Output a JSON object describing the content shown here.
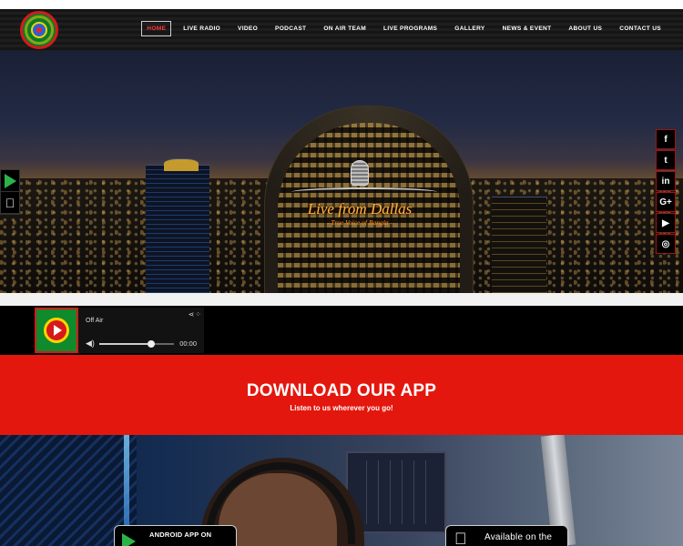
{
  "nav": {
    "items": [
      {
        "label": "HOME",
        "active": true
      },
      {
        "label": "LIVE RADIO"
      },
      {
        "label": "VIDEO"
      },
      {
        "label": "PODCAST"
      },
      {
        "label": "ON AIR TEAM"
      },
      {
        "label": "LIVE PROGRAMS"
      },
      {
        "label": "GALLERY"
      },
      {
        "label": "NEWS & EVENT"
      },
      {
        "label": "ABOUT US"
      },
      {
        "label": "CONTACT US"
      }
    ]
  },
  "hero": {
    "title": "Live from Dallas",
    "subtitle": "- True Voice of Bangla -"
  },
  "social": {
    "icons": [
      "facebook-icon",
      "twitter-icon",
      "linkedin-icon",
      "google-plus-icon",
      "youtube-icon",
      "instagram-icon"
    ],
    "glyphs": [
      "f",
      "t",
      "in",
      "G+",
      "▶",
      "◎"
    ]
  },
  "side_apps": {
    "icons": [
      "google-play-icon",
      "apple-icon"
    ]
  },
  "player": {
    "status": "Off Air",
    "time": "00:00",
    "volume": 0.7,
    "share_glyph": "⋖⁘",
    "volume_glyph": "◀)"
  },
  "download": {
    "heading": "DOWNLOAD OUR APP",
    "tagline": "Listen to us wherever you go!"
  },
  "badges": {
    "android": "ANDROID APP ON",
    "ios": "Available on the"
  },
  "colors": {
    "accent": "#e3170d",
    "nav_bg": "#1a1a1a"
  }
}
